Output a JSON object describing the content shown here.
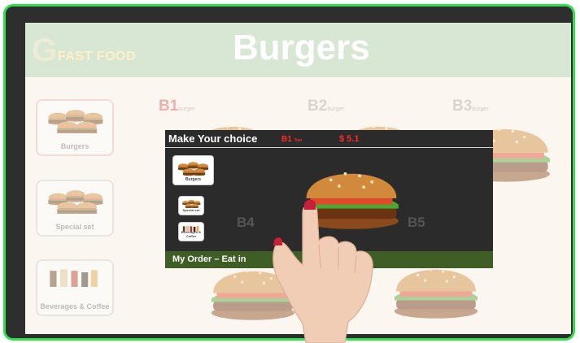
{
  "header": {
    "logo_letter": "G",
    "logo_text": "FAST FOOD",
    "title": "Burgers"
  },
  "categories": [
    {
      "label": "Burgers"
    },
    {
      "label": "Special set"
    },
    {
      "label": "Beverages & Coffee"
    }
  ],
  "menu_items": [
    {
      "code": "B1",
      "sub": "burger"
    },
    {
      "code": "B2",
      "sub": "burger"
    },
    {
      "code": "B3",
      "sub": "burger"
    },
    {
      "code": "B4",
      "sub": ""
    },
    {
      "code": "B5",
      "sub": ""
    }
  ],
  "modal": {
    "title": "Make Your choice",
    "selected_code": "B1",
    "selected_sub": "Two",
    "price": "$ 5.1",
    "side_categories": [
      {
        "label": "Burgers"
      },
      {
        "label": "Special set"
      },
      {
        "label": "Beverages & Coffee"
      }
    ],
    "footer": "My Order – Eat in"
  },
  "colors": {
    "frame_border": "#2ee04a",
    "header_bg": "#d8e7d3",
    "accent_red": "#ff2a2a",
    "footer_green": "#3e5e26"
  },
  "icons": [
    "burger-icon",
    "hand-icon"
  ]
}
